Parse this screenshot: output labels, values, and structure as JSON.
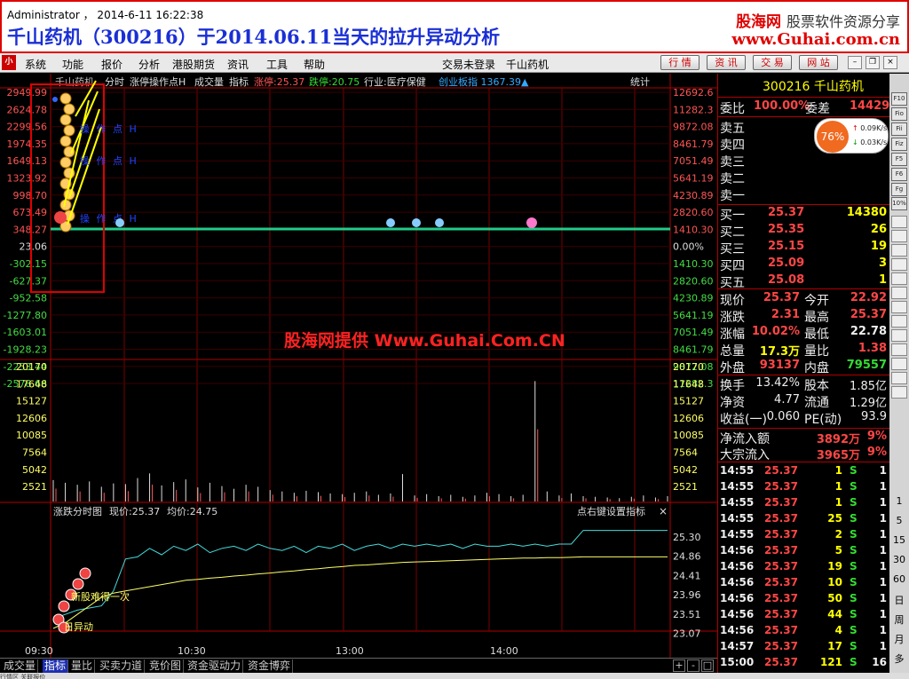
{
  "header": {
    "user_line": "Administrator ， 2014-6-11 16:22:38",
    "title": "千山药机（300216）于2014.06.11当天的拉升异动分析",
    "brand_cn": "股海网",
    "brand_sub": "股票软件资源分享",
    "brand_url": "www.Guhai.com.cn"
  },
  "menu": {
    "logo": "小",
    "items": [
      "系统",
      "功能",
      "报价",
      "分析",
      "港股期货",
      "资讯",
      "工具",
      "帮助"
    ],
    "login_status": "交易未登录",
    "stock_name": "千山药机",
    "top_buttons": [
      "行 情",
      "资 讯",
      "交 易",
      "网 站"
    ],
    "window_buttons": [
      "–",
      "❐",
      "×"
    ]
  },
  "chart_bar": {
    "stock": "千山药机",
    "mode": "分时",
    "indicator": "涨停操作点H",
    "vol_label": "成交量",
    "indicator_label": "指标",
    "limit_up": "涨停:25.37",
    "limit_down": "跌停:20.75",
    "industry": "行业:医疗保健",
    "index_info": "创业板指 1367.39▲",
    "stats_btn": "统计"
  },
  "watermark": "股海网提供 Www.Guhai.Com.CN",
  "price_axis": {
    "left": [
      "2949.99",
      "2624.78",
      "2299.56",
      "1974.35",
      "1649.13",
      "1323.92",
      "998.70",
      "673.49",
      "348.27",
      "23.06",
      "-302.15",
      "-627.37",
      "-952.58",
      "-1277.80",
      "-1603.01",
      "-1928.23",
      "-2253.44",
      "-2578.66"
    ],
    "right": [
      "12692.6",
      "11282.3",
      "9872.08",
      "8461.79",
      "7051.49",
      "5641.19",
      "4230.89",
      "2820.60",
      "1410.30",
      "0.00%",
      "1410.30",
      "2820.60",
      "4230.89",
      "5641.19",
      "7051.49",
      "8461.79",
      "9872.08",
      "11282.3"
    ]
  },
  "volume_axis": [
    "20170",
    "17648",
    "15127",
    "12606",
    "10085",
    "7564",
    "5042",
    "2521"
  ],
  "chart_text": {
    "op_marker": "涨停操作点H",
    "op_chars": "操 作 点 H"
  },
  "subchart": {
    "title": "涨跌分时图",
    "price": "现价:25.37",
    "avg": "均价:24.75",
    "hint": "点右键设置指标",
    "close": "×",
    "axis": [
      "25.30",
      "24.86",
      "24.41",
      "23.96",
      "23.51",
      "23.07"
    ],
    "note1": "新股难得一次",
    "note2": "日异动",
    "time_axis": [
      "09:30",
      "10:30",
      "13:00",
      "14:00"
    ]
  },
  "chart_data": [
    {
      "type": "line",
      "title": "涨跌分时图",
      "series": [
        {
          "name": "现价",
          "values": [
            23.3,
            23.4,
            23.5,
            23.55,
            23.6,
            23.95,
            24.7,
            24.75,
            24.95,
            24.8,
            25.0,
            24.9,
            25.05,
            24.85,
            24.95,
            25.0,
            24.9,
            25.05,
            24.95,
            24.9,
            25.0,
            24.85,
            25.0,
            24.95,
            25.05,
            24.9,
            25.0,
            25.05,
            24.95,
            25.05,
            25.0,
            25.05,
            25.0,
            25.05,
            24.95,
            25.05,
            25.0,
            25.0,
            25.05,
            25.0,
            25.05,
            25.0,
            25.05,
            25.05,
            25.37,
            25.37,
            25.37,
            25.37,
            25.37,
            25.37,
            25.37,
            25.37
          ]
        },
        {
          "name": "均价",
          "values": [
            23.07,
            23.2,
            23.4,
            23.6,
            23.8,
            23.9,
            23.95,
            24.0,
            24.05,
            24.1,
            24.15,
            24.2,
            24.22,
            24.25,
            24.27,
            24.3,
            24.32,
            24.35,
            24.37,
            24.4,
            24.42,
            24.45,
            24.47,
            24.5,
            24.52,
            24.55,
            24.56,
            24.58,
            24.6,
            24.62,
            24.63,
            24.64,
            24.65,
            24.66,
            24.67,
            24.68,
            24.69,
            24.7,
            24.71,
            24.72,
            24.72,
            24.73,
            24.73,
            24.74,
            24.75,
            24.75,
            24.75,
            24.75,
            24.75,
            24.75,
            24.75,
            24.75
          ]
        }
      ],
      "ylim": [
        23.07,
        25.3
      ]
    },
    {
      "type": "bar",
      "title": "成交量",
      "values": [
        3200,
        2800,
        2500,
        3000,
        2200,
        2700,
        2600,
        3500,
        4200,
        2400,
        2900,
        3300,
        2100,
        2800,
        2300,
        1900,
        2500,
        2200,
        1700,
        1500,
        1300,
        1600,
        1400,
        1200,
        1100,
        1300,
        1500,
        1000,
        1200,
        4100,
        900,
        1100,
        800,
        1000,
        700,
        900,
        1300,
        1100,
        800,
        1000,
        18000,
        1500,
        900,
        1200,
        800,
        700,
        600,
        500,
        700,
        900,
        600,
        800
      ],
      "ylim": [
        0,
        20170
      ]
    }
  ],
  "quote": {
    "code_name": "300216 千山药机",
    "weibi_label": "委比",
    "weibi_val": "100.00%",
    "weicha_label": "委差",
    "weicha_val": "14429",
    "sells": [
      "卖五",
      "卖四",
      "卖三",
      "卖二",
      "卖一"
    ],
    "speed_pct": "76%",
    "speed_up": "0.09K/s",
    "speed_down": "0.03K/s",
    "buys": [
      {
        "label": "买一",
        "price": "25.37",
        "vol": "14380"
      },
      {
        "label": "买二",
        "price": "25.35",
        "vol": "26"
      },
      {
        "label": "买三",
        "price": "25.15",
        "vol": "19"
      },
      {
        "label": "买四",
        "price": "25.09",
        "vol": "3"
      },
      {
        "label": "买五",
        "price": "25.08",
        "vol": "1"
      }
    ],
    "stats": [
      {
        "l1": "现价",
        "v1": "25.37",
        "c1": "red",
        "l2": "今开",
        "v2": "22.92",
        "c2": "red"
      },
      {
        "l1": "涨跌",
        "v1": "2.31",
        "c1": "red",
        "l2": "最高",
        "v2": "25.37",
        "c2": "red"
      },
      {
        "l1": "涨幅",
        "v1": "10.02%",
        "c1": "red",
        "l2": "最低",
        "v2": "22.78",
        "c2": "white"
      },
      {
        "l1": "总量",
        "v1": "17.3万",
        "c1": "yellow",
        "l2": "量比",
        "v2": "1.38",
        "c2": "red"
      },
      {
        "l1": "外盘",
        "v1": "93137",
        "c1": "red",
        "l2": "内盘",
        "v2": "79557",
        "c2": "green"
      }
    ],
    "stats2": [
      {
        "l1": "换手",
        "v1": "13.42%",
        "l2": "股本",
        "v2": "1.85亿"
      },
      {
        "l1": "净资",
        "v1": "4.77",
        "l2": "流通",
        "v2": "1.29亿"
      },
      {
        "l1": "收益(一)",
        "v1": "0.060",
        "l2": "PE(动)",
        "v2": "93.9"
      }
    ],
    "flows": [
      {
        "label": "净流入额",
        "val": "3892万",
        "pct": "9%"
      },
      {
        "label": "大宗流入",
        "val": "3965万",
        "pct": "9%"
      }
    ],
    "ticks": [
      {
        "t": "14:55",
        "p": "25.37",
        "v": "1",
        "s": "S",
        "n": "1"
      },
      {
        "t": "14:55",
        "p": "25.37",
        "v": "1",
        "s": "S",
        "n": "1"
      },
      {
        "t": "14:55",
        "p": "25.37",
        "v": "1",
        "s": "S",
        "n": "1"
      },
      {
        "t": "14:55",
        "p": "25.37",
        "v": "25",
        "s": "S",
        "n": "1"
      },
      {
        "t": "14:55",
        "p": "25.37",
        "v": "2",
        "s": "S",
        "n": "1"
      },
      {
        "t": "14:56",
        "p": "25.37",
        "v": "5",
        "s": "S",
        "n": "1"
      },
      {
        "t": "14:56",
        "p": "25.37",
        "v": "19",
        "s": "S",
        "n": "1"
      },
      {
        "t": "14:56",
        "p": "25.37",
        "v": "10",
        "s": "S",
        "n": "1"
      },
      {
        "t": "14:56",
        "p": "25.37",
        "v": "50",
        "s": "S",
        "n": "1"
      },
      {
        "t": "14:56",
        "p": "25.37",
        "v": "44",
        "s": "S",
        "n": "1"
      },
      {
        "t": "14:56",
        "p": "25.37",
        "v": "4",
        "s": "S",
        "n": "1"
      },
      {
        "t": "14:57",
        "p": "25.37",
        "v": "17",
        "s": "S",
        "n": "1"
      },
      {
        "t": "15:00",
        "p": "25.37",
        "v": "121",
        "s": "S",
        "n": "16"
      }
    ]
  },
  "bottom_tabs": [
    "成交量",
    "指标",
    "量比",
    "买卖力道",
    "竞价图",
    "资金驱动力",
    "资金博弈"
  ],
  "bottom_ctrl": [
    "+",
    "-",
    "□"
  ],
  "bottom_strip": "行情区    关联报价",
  "side_icons": [
    "F10",
    "Fio",
    "Fii",
    "Fiz",
    "F5",
    "F6",
    "Fg",
    "10%"
  ],
  "side_text": [
    "1",
    "5",
    "15",
    "30",
    "60",
    "日",
    "周",
    "月",
    "多"
  ]
}
